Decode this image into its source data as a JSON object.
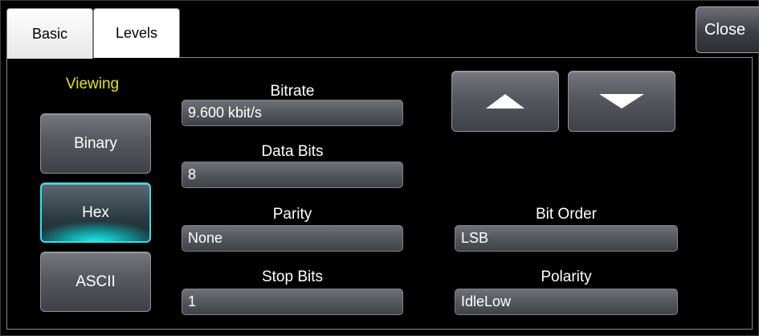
{
  "tabs": {
    "basic": "Basic",
    "levels": "Levels"
  },
  "close_label": "Close",
  "viewing": {
    "title": "Viewing",
    "binary": "Binary",
    "hex": "Hex",
    "ascii": "ASCII",
    "selected": "Hex"
  },
  "fields": {
    "bitrate": {
      "label": "Bitrate",
      "value": "9.600 kbit/s"
    },
    "data_bits": {
      "label": "Data Bits",
      "value": "8"
    },
    "parity": {
      "label": "Parity",
      "value": "None"
    },
    "stop_bits": {
      "label": "Stop Bits",
      "value": "1"
    },
    "bit_order": {
      "label": "Bit Order",
      "value": "LSB"
    },
    "polarity": {
      "label": "Polarity",
      "value": "IdleLow"
    }
  },
  "colors": {
    "accent": "#35e0e0",
    "viewing_label": "#e6e600"
  },
  "icons": {
    "up": "up-arrow-icon",
    "down": "down-arrow-icon"
  }
}
